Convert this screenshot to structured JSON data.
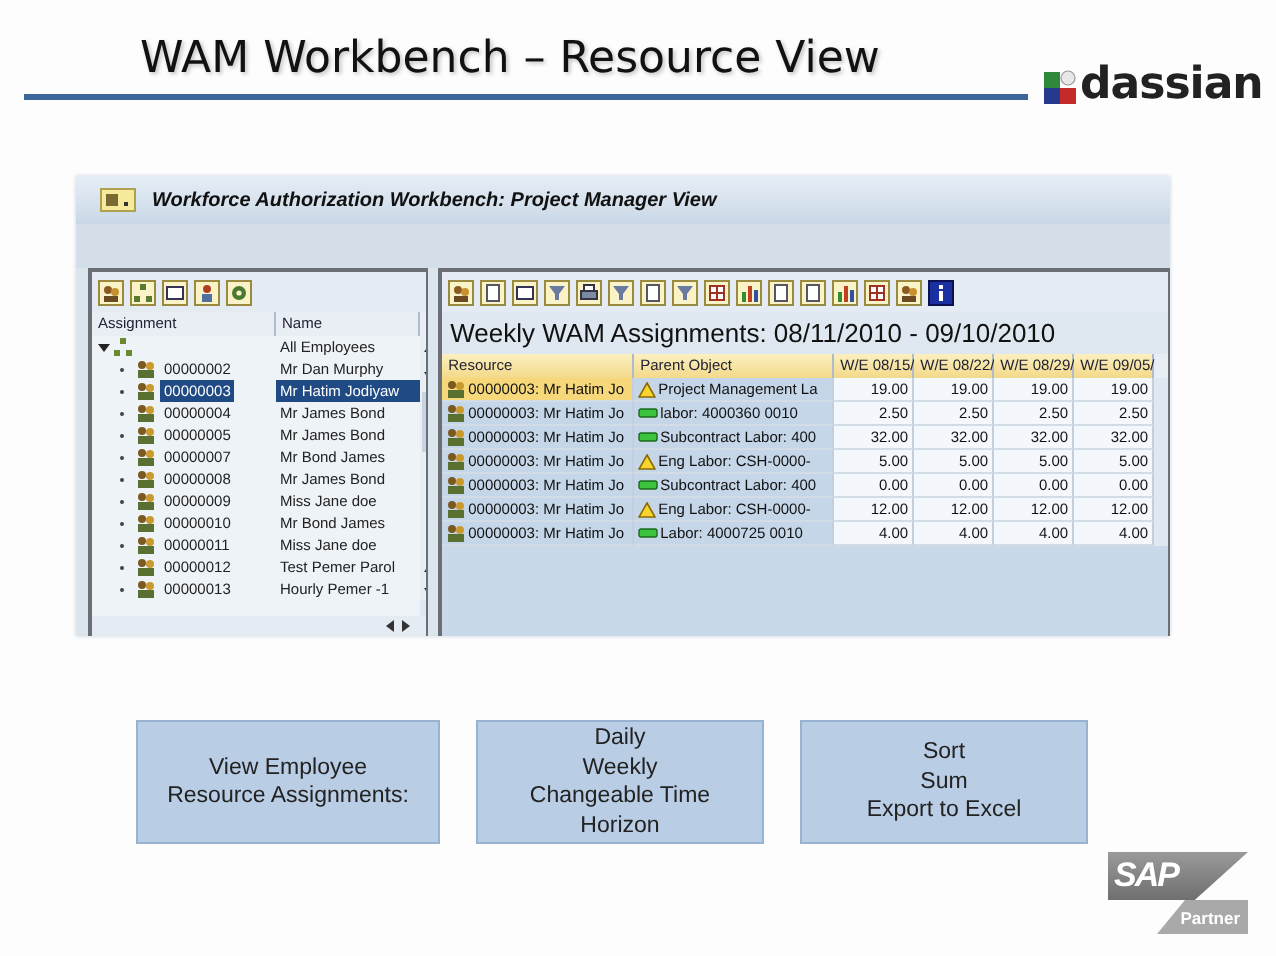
{
  "slide": {
    "title": "WAM Workbench – Resource View",
    "logo_text": "dassian"
  },
  "window": {
    "title": "Workforce Authorization Workbench: Project Manager View"
  },
  "tree": {
    "columns": [
      "Assignment",
      "Name"
    ],
    "root": {
      "name": "All Employees",
      "expanded": true,
      "children": [
        {
          "assignment": "00000002",
          "name": "Mr Dan Murphy",
          "selected": false
        },
        {
          "assignment": "00000003",
          "name": "Mr Hatim Jodiyaw",
          "selected": true
        },
        {
          "assignment": "00000004",
          "name": "Mr James Bond",
          "selected": false
        },
        {
          "assignment": "00000005",
          "name": "Mr James Bond",
          "selected": false
        },
        {
          "assignment": "00000007",
          "name": "Mr Bond James",
          "selected": false
        },
        {
          "assignment": "00000008",
          "name": "Mr James Bond",
          "selected": false
        },
        {
          "assignment": "00000009",
          "name": "Miss Jane doe",
          "selected": false
        },
        {
          "assignment": "00000010",
          "name": "Mr Bond James",
          "selected": false
        },
        {
          "assignment": "00000011",
          "name": "Miss Jane doe",
          "selected": false
        },
        {
          "assignment": "00000012",
          "name": "Test Pemer Parol",
          "selected": false
        },
        {
          "assignment": "00000013",
          "name": "Hourly Pemer -1",
          "selected": false
        }
      ]
    }
  },
  "report": {
    "title": "Weekly WAM Assignments: 08/11/2010 - 09/10/2010",
    "columns": [
      "Resource",
      "Parent Object",
      "W/E 08/15/",
      "W/E 08/22/",
      "W/E 08/29/",
      "W/E 09/05/"
    ],
    "rows": [
      {
        "resource": "00000003: Mr Hatim Jo",
        "kind": "warning",
        "parent": "Project Management La",
        "values": [
          "19.00",
          "19.00",
          "19.00",
          "19.00"
        ],
        "selected": true
      },
      {
        "resource": "00000003: Mr Hatim Jo",
        "kind": "ok",
        "parent": "labor: 4000360 0010",
        "values": [
          "2.50",
          "2.50",
          "2.50",
          "2.50"
        ],
        "selected": false
      },
      {
        "resource": "00000003: Mr Hatim Jo",
        "kind": "ok",
        "parent": "Subcontract Labor: 400",
        "values": [
          "32.00",
          "32.00",
          "32.00",
          "32.00"
        ],
        "selected": false
      },
      {
        "resource": "00000003: Mr Hatim Jo",
        "kind": "warning",
        "parent": "Eng Labor: CSH-0000-",
        "values": [
          "5.00",
          "5.00",
          "5.00",
          "5.00"
        ],
        "selected": false
      },
      {
        "resource": "00000003: Mr Hatim Jo",
        "kind": "ok",
        "parent": "Subcontract Labor: 400",
        "values": [
          "0.00",
          "0.00",
          "0.00",
          "0.00"
        ],
        "selected": false
      },
      {
        "resource": "00000003: Mr Hatim Jo",
        "kind": "warning",
        "parent": "Eng Labor: CSH-0000-",
        "values": [
          "12.00",
          "12.00",
          "12.00",
          "12.00"
        ],
        "selected": false
      },
      {
        "resource": "00000003: Mr Hatim Jo",
        "kind": "ok",
        "parent": "Labor: 4000725 0010",
        "values": [
          "4.00",
          "4.00",
          "4.00",
          "4.00"
        ],
        "selected": false
      }
    ]
  },
  "callouts": [
    {
      "lines": [
        "View Employee",
        "Resource Assignments:"
      ]
    },
    {
      "lines": [
        "Daily",
        "Weekly",
        "Changeable Time",
        "Horizon"
      ]
    },
    {
      "lines": [
        "Sort",
        "Sum",
        "Export to Excel"
      ]
    }
  ],
  "partner_logo": {
    "brand": "SAP",
    "label": "Partner"
  }
}
